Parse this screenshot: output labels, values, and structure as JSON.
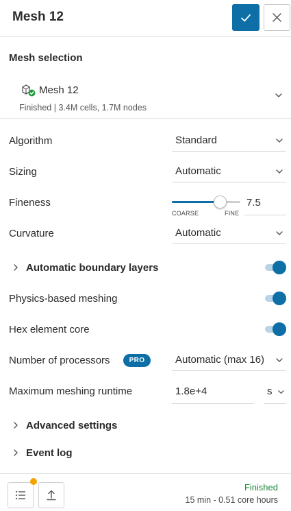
{
  "header": {
    "title": "Mesh 12"
  },
  "mesh_selection": {
    "title": "Mesh selection",
    "mesh_name": "Mesh 12",
    "mesh_meta": "Finished | 3.4M cells, 1.7M nodes"
  },
  "settings": {
    "algorithm": {
      "label": "Algorithm",
      "value": "Standard"
    },
    "sizing": {
      "label": "Sizing",
      "value": "Automatic"
    },
    "fineness": {
      "label": "Fineness",
      "value": "7.5",
      "min_label": "COARSE",
      "max_label": "FINE",
      "fraction": 0.7
    },
    "curvature": {
      "label": "Curvature",
      "value": "Automatic"
    },
    "boundary_layers": {
      "label": "Automatic boundary layers",
      "enabled": true
    },
    "physics_meshing": {
      "label": "Physics-based meshing",
      "enabled": true
    },
    "hex_core": {
      "label": "Hex element core",
      "enabled": true
    },
    "processors": {
      "label": "Number of processors",
      "badge": "PRO",
      "value": "Automatic (max 16)"
    },
    "runtime": {
      "label": "Maximum meshing runtime",
      "value": "1.8e+4",
      "unit": "s"
    }
  },
  "sections": {
    "advanced": "Advanced settings",
    "event_log": "Event log"
  },
  "footer": {
    "status": "Finished",
    "status_detail": "15 min - 0.51 core hours"
  },
  "colors": {
    "accent": "#0d6fa5",
    "status_ok": "#1f8a3a",
    "notification": "#f4a300"
  }
}
